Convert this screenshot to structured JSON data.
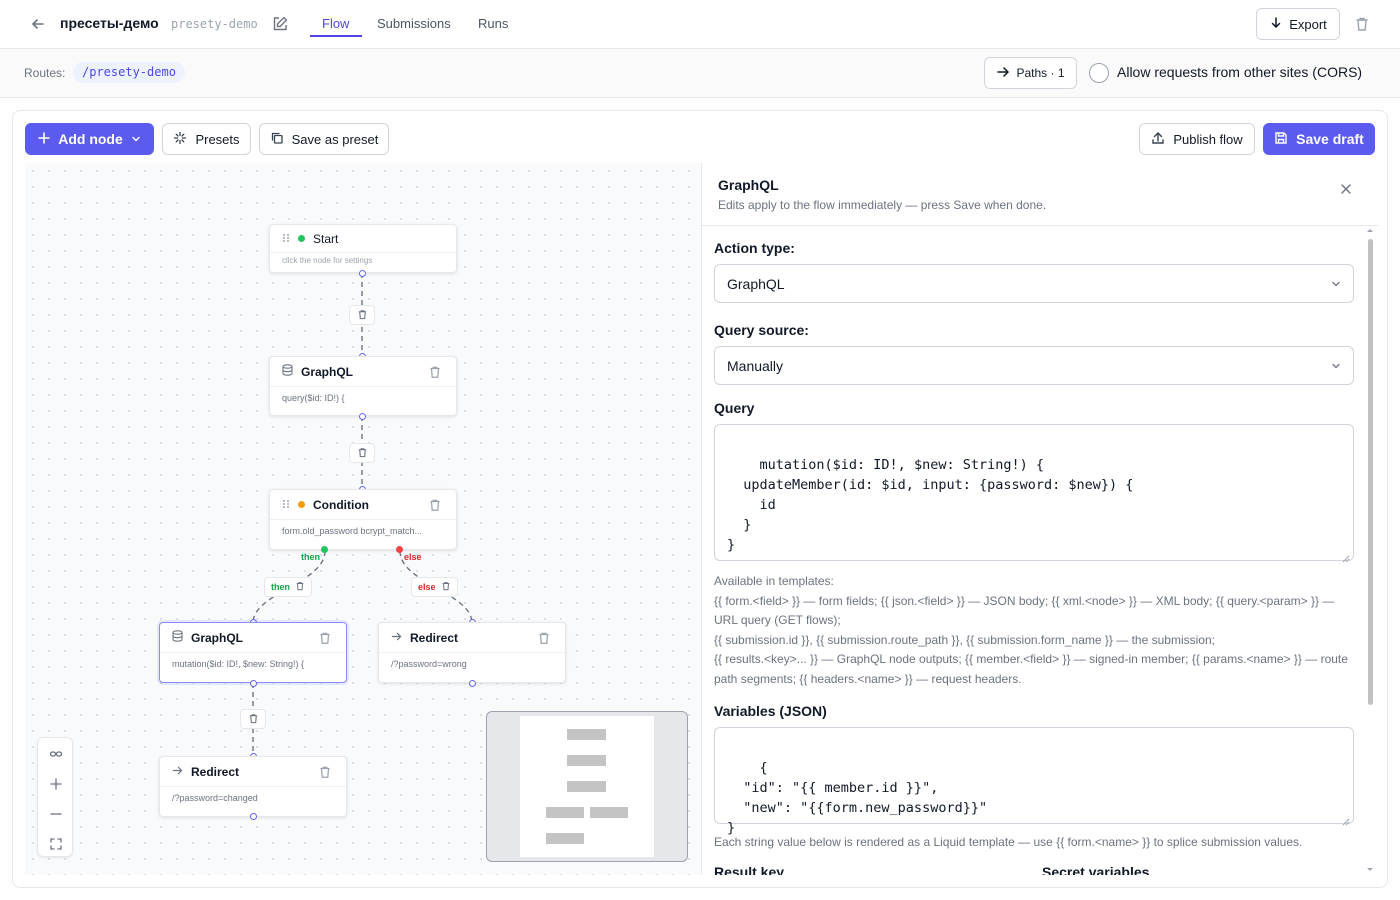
{
  "header": {
    "title": "пресеты-демо",
    "slug": "presety-demo",
    "tabs": [
      {
        "label": "Flow",
        "active": true
      },
      {
        "label": "Submissions",
        "active": false
      },
      {
        "label": "Runs",
        "active": false
      }
    ],
    "export_label": "Export"
  },
  "routes": {
    "label": "Routes:",
    "items": [
      "/presety-demo"
    ],
    "paths_label": "Paths · 1",
    "cors_label": "Allow requests from other sites (CORS)",
    "cors_enabled": false
  },
  "toolbar": {
    "add_node_label": "Add node",
    "presets_label": "Presets",
    "save_as_preset_label": "Save as preset",
    "publish_label": "Publish flow",
    "save_draft_label": "Save draft"
  },
  "canvas": {
    "nodes": [
      {
        "id": "start",
        "title": "Start",
        "subtitle": "click the node for settings"
      },
      {
        "id": "graphql-1",
        "title": "GraphQL",
        "subtitle": "query($id: ID!) {"
      },
      {
        "id": "condition",
        "title": "Condition",
        "subtitle": "form.old_password bcrypt_match..."
      },
      {
        "id": "graphql-2",
        "title": "GraphQL",
        "subtitle": "mutation($id: ID!, $new: String!) {",
        "selected": true
      },
      {
        "id": "redirect-else",
        "title": "Redirect",
        "subtitle": "/?password=wrong"
      },
      {
        "id": "redirect-then",
        "title": "Redirect",
        "subtitle": "/?password=changed"
      }
    ],
    "branches": {
      "then": "then",
      "else": "else"
    }
  },
  "panel": {
    "title": "GraphQL",
    "subtitle": "Edits apply to the flow immediately — press Save when done.",
    "action_type_label": "Action type:",
    "action_type_value": "GraphQL",
    "query_source_label": "Query source:",
    "query_source_value": "Manually",
    "query_label": "Query",
    "query_value": "mutation($id: ID!, $new: String!) {\n  updateMember(id: $id, input: {password: $new}) {\n    id\n  }\n}",
    "templates_help": [
      "Available in templates:",
      "{{ form.<field> }} — form fields; {{ json.<field> }} — JSON body; {{ xml.<node> }} — XML body; {{ query.<param> }} — URL query (GET flows);",
      "{{ submission.id }}, {{ submission.route_path }}, {{ submission.form_name }} — the submission;",
      "{{ results.<key>... }} — GraphQL node outputs; {{ member.<field> }} — signed-in member; {{ params.<name> }} — route path segments; {{ headers.<name> }} — request headers."
    ],
    "variables_label": "Variables (JSON)",
    "variables_value": "{\n  \"id\": \"{{ member.id }}\",\n  \"new\": \"{{form.new_password}}\"\n}",
    "variables_help": "Each string value below is rendered as a Liquid template — use {{ form.<name> }} to splice submission values.",
    "result_key_label": "Result key",
    "secret_variables_label": "Secret variables"
  },
  "colors": {
    "accent": "#5b5bf0",
    "start_dot": "#22c55e",
    "condition_dot": "#f59e0b",
    "then": "#16a34a",
    "else": "#dc2626"
  }
}
